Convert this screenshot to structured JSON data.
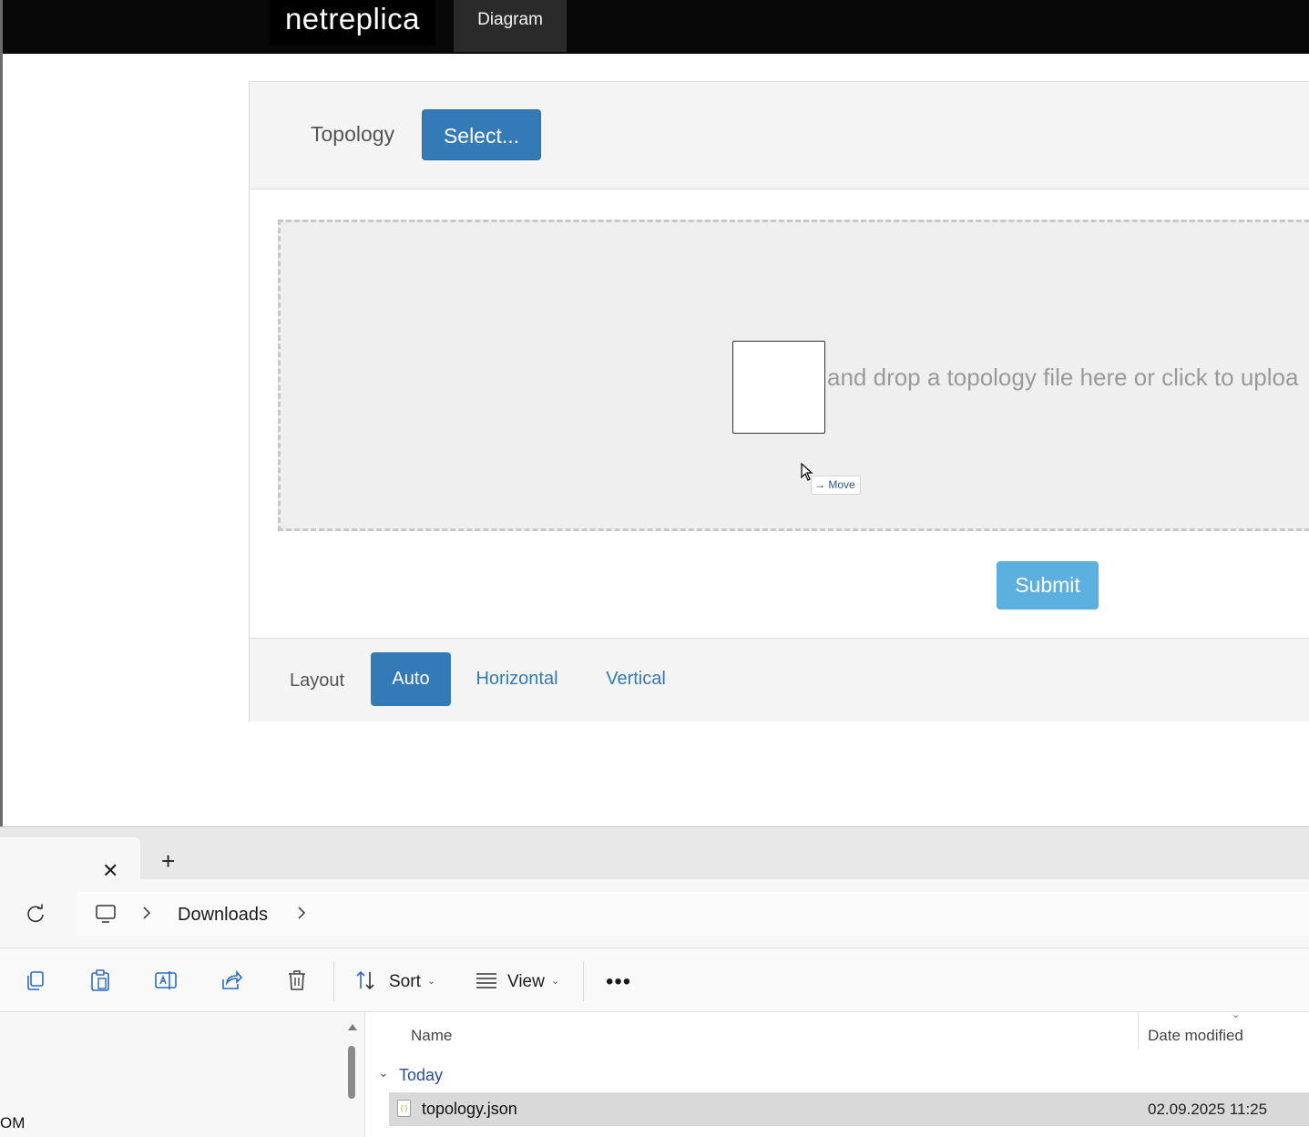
{
  "navbar": {
    "brand": "netreplica",
    "tab_diagram": "Diagram"
  },
  "topology_card": {
    "topology_label": "Topology",
    "select_button": "Select...",
    "dropzone_text": "and drop a topology file here or click to uploa",
    "drag_tooltip": "Move",
    "submit_button": "Submit"
  },
  "layout": {
    "label": "Layout",
    "options": [
      "Auto",
      "Horizontal",
      "Vertical"
    ],
    "selected": "Auto"
  },
  "explorer": {
    "tab_close_glyph": "✕",
    "new_tab_glyph": "+",
    "breadcrumb": [
      "Downloads"
    ],
    "commands": {
      "sort": "Sort",
      "view": "View",
      "more": "•••"
    },
    "nav_pane_text": "OM",
    "columns": {
      "name": "Name",
      "date_modified": "Date modified"
    },
    "group": "Today",
    "files": [
      {
        "name": "topology.json",
        "date_modified": "02.09.2025 11:25",
        "selected": true
      }
    ]
  },
  "colors": {
    "primary": "#337ab7",
    "submit": "#5bb0e0",
    "navbar_bg": "#080808"
  },
  "icons": [
    "copy-icon",
    "paste-icon",
    "rename-icon",
    "share-icon",
    "delete-icon",
    "sort-icon",
    "view-icon",
    "refresh-icon",
    "this-pc-icon",
    "json-file-icon"
  ]
}
